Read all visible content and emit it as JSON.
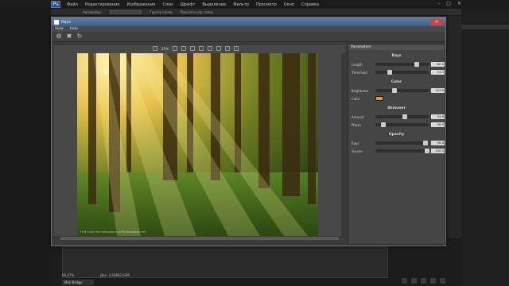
{
  "photoshop": {
    "logo": "Ps",
    "menu": [
      "Файл",
      "Редактирование",
      "Изображение",
      "Слои",
      "Шрифт",
      "Выделение",
      "Фильтр",
      "Просмотр",
      "Окно",
      "Справка"
    ],
    "options": [
      "Автовыбор:",
      "Группу слоев",
      "Показать упр. элем."
    ],
    "status_zoom": "66,67%",
    "status_doc": "Док: 2,93М/2,93М",
    "mini_bridge": "Mini Bridge"
  },
  "plugin": {
    "title": "Rays",
    "close": "✕",
    "menu": [
      "View",
      "Help"
    ],
    "toolbar_icons": [
      "gear-icon",
      "x-icon",
      "redo-icon"
    ],
    "canvas_zoom": "25%",
    "photo_caption": "Find more free wallpapers on Picswallpaper.net"
  },
  "parameters": {
    "header": "Parameters",
    "sections": [
      {
        "title": "Rays",
        "rows": [
          {
            "label": "Length",
            "value": "80.0",
            "level": 0.8
          },
          {
            "label": "Threshold",
            "value": "24.4",
            "level": 0.24
          }
        ]
      },
      {
        "title": "Color",
        "rows": [
          {
            "label": "Brightness",
            "value": "103.6",
            "level": 0.35
          },
          {
            "label": "Color",
            "swatch": "#e89a1a"
          }
        ]
      },
      {
        "title": "Shimmer",
        "rows": [
          {
            "label": "Amount",
            "value": "54.8",
            "level": 0.55
          },
          {
            "label": "Phase",
            "value": "36.5",
            "level": 0.12
          }
        ]
      },
      {
        "title": "Opacity",
        "rows": [
          {
            "label": "Rays",
            "value": "96.8",
            "level": 0.97
          },
          {
            "label": "Source",
            "value": "100.0",
            "level": 1.0
          }
        ]
      }
    ]
  },
  "colors": {
    "ray_gold": "#f2c23a",
    "title_blue": "#4f73a0"
  }
}
